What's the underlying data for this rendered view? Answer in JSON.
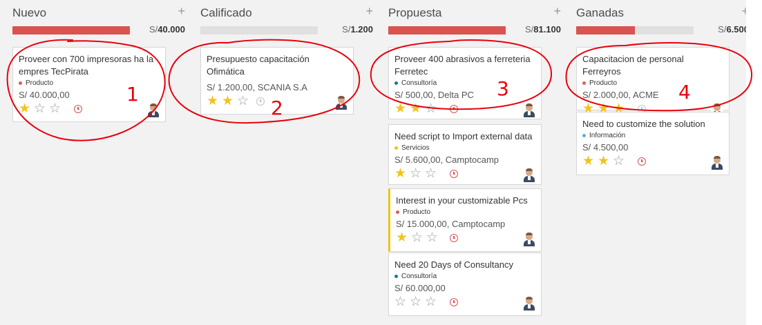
{
  "currency": "S/",
  "columns": [
    {
      "title": "Nuevo",
      "total": "40.000",
      "progress": 1.0,
      "cards": [
        {
          "title": "Proveer con 700 impresoras ha la empres TecPirata",
          "tag": "Producto",
          "tag_color": "#e05c56",
          "amount": "S/ 40.000,00",
          "stars": 1,
          "activity": "overdue"
        }
      ]
    },
    {
      "title": "Calificado",
      "total": "1.200",
      "progress": 0.0,
      "cards": [
        {
          "title": "Presupuesto capacitación Ofimática",
          "tag": "",
          "tag_color": "",
          "amount": "S/ 1.200,00, SCANIA S.A",
          "stars": 2,
          "activity": "none"
        }
      ]
    },
    {
      "title": "Propuesta",
      "total": "81.100",
      "progress": 1.0,
      "cards": [
        {
          "title": "Proveer 400 abrasivos a ferreteria Ferretec",
          "tag": "Consultoría",
          "tag_color": "#1d7b8c",
          "amount": "S/ 500,00, Delta PC",
          "stars": 2,
          "activity": "overdue"
        },
        {
          "title": "Need script to Import external data",
          "tag": "Servicios",
          "tag_color": "#f0c30f",
          "amount": "S/ 5.600,00, Camptocamp",
          "stars": 1,
          "activity": "overdue"
        },
        {
          "title": "Interest in your customizable Pcs",
          "tag": "Producto",
          "tag_color": "#e05c56",
          "amount": "S/ 15.000,00, Camptocamp",
          "stars": 1,
          "activity": "overdue",
          "highlight": true
        },
        {
          "title": "Need 20 Days of Consultancy",
          "tag": "Consultoría",
          "tag_color": "#1d7b8c",
          "amount": "S/ 60.000,00",
          "stars": 0,
          "activity": "overdue"
        }
      ]
    },
    {
      "title": "Ganadas",
      "total": "6.500",
      "progress": 0.5,
      "cards": [
        {
          "title": "Capacitacion de personal Ferreyros",
          "tag": "Producto",
          "tag_color": "#e05c56",
          "amount": "S/ 2.000,00, ACME",
          "stars": 3,
          "activity": "none"
        },
        {
          "title": "Need to customize the solution",
          "tag": "Información",
          "tag_color": "#5aaee6",
          "amount": "S/ 4.500,00",
          "stars": 2,
          "activity": "overdue"
        }
      ]
    }
  ],
  "annotations": [
    "1",
    "2",
    "3",
    "4"
  ],
  "colors": {
    "accent_red": "#d9534f",
    "star_gold": "#f3c319",
    "annotation_red": "#e8000b"
  }
}
